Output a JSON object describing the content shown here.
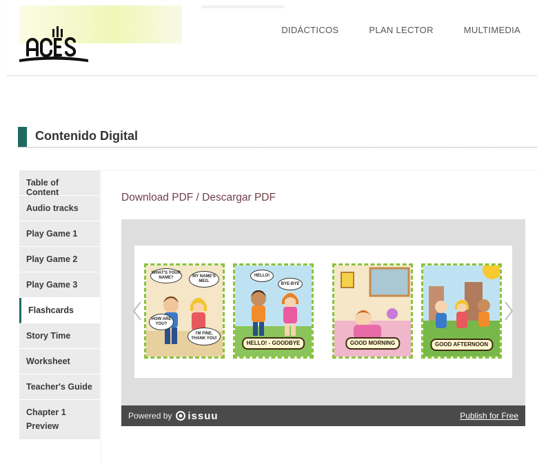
{
  "header": {
    "nav": [
      "DIDÁCTICOS",
      "PLAN LECTOR",
      "MULTIMEDIA"
    ]
  },
  "section": {
    "title": "Contenido Digital"
  },
  "sidebar": {
    "items": [
      {
        "label": "Table of Content"
      },
      {
        "label": "Audio tracks"
      },
      {
        "label": "Play Game 1"
      },
      {
        "label": "Play Game 2"
      },
      {
        "label": "Play Game 3"
      },
      {
        "label": "Flashcards",
        "active": true
      },
      {
        "label": "Story Time"
      },
      {
        "label": "Worksheet"
      },
      {
        "label": "Teacher's Guide"
      },
      {
        "label": "Chapter 1 Preview"
      }
    ]
  },
  "main": {
    "download_label": "Download PDF / Descargar PDF",
    "viewer": {
      "cards": [
        {
          "bubbles": [
            "WHAT'S YOUR NAME?",
            "MY NAME'S MEG.",
            "HOW ARE YOU?",
            "I'M FINE, THANK YOU!"
          ]
        },
        {
          "bubbles": [
            "HELLO!",
            "BYE-BYE"
          ],
          "label": "HELLO! - GOODBYE"
        },
        {
          "label": "GOOD MORNING"
        },
        {
          "label": "GOOD AFTERNOON"
        }
      ],
      "powered_by": "Powered by",
      "brand": "issuu",
      "publish_label": "Publish for Free"
    }
  },
  "colors": {
    "accent": "#1f6b64",
    "link": "#6f3e4a",
    "card_border": "#8ac23c"
  }
}
